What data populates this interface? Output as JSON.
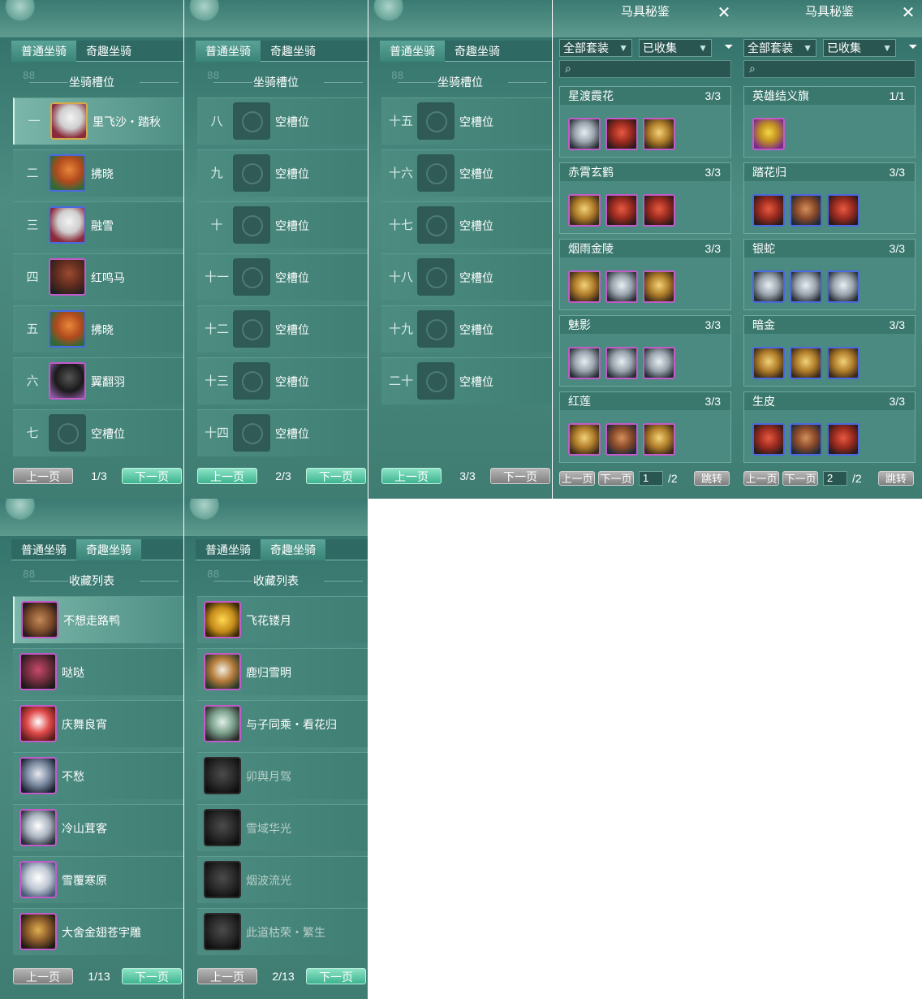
{
  "tabs": {
    "normal": "普通坐骑",
    "novelty": "奇趣坐骑"
  },
  "mount_slots_title": "坐骑槽位",
  "collection_list_title": "收藏列表",
  "ghost_text": "88",
  "pagination": {
    "prev": "上一页",
    "next": "下一页",
    "jump": "跳转"
  },
  "slot_panels": [
    {
      "page": "1/3",
      "slots": [
        {
          "num": "一",
          "label": "里飞沙・踏秋",
          "icon": "white-horse-icon"
        },
        {
          "num": "二",
          "label": "拂晓",
          "icon": "chestnut-horse-icon"
        },
        {
          "num": "三",
          "label": "融雪",
          "icon": "white-horse-icon"
        },
        {
          "num": "四",
          "label": "红鸣马",
          "icon": "brown-horse-icon"
        },
        {
          "num": "五",
          "label": "拂晓",
          "icon": "chestnut-horse-icon"
        },
        {
          "num": "六",
          "label": "翼翻羽",
          "icon": "black-horse-icon"
        },
        {
          "num": "七",
          "label": "空槽位",
          "icon": "empty-slot-icon"
        }
      ]
    },
    {
      "page": "2/3",
      "slots": [
        {
          "num": "八",
          "label": "空槽位"
        },
        {
          "num": "九",
          "label": "空槽位"
        },
        {
          "num": "十",
          "label": "空槽位"
        },
        {
          "num": "十一",
          "label": "空槽位"
        },
        {
          "num": "十二",
          "label": "空槽位"
        },
        {
          "num": "十三",
          "label": "空槽位"
        },
        {
          "num": "十四",
          "label": "空槽位"
        }
      ]
    },
    {
      "page": "3/3",
      "slots": [
        {
          "num": "十五",
          "label": "空槽位"
        },
        {
          "num": "十六",
          "label": "空槽位"
        },
        {
          "num": "十七",
          "label": "空槽位"
        },
        {
          "num": "十八",
          "label": "空槽位"
        },
        {
          "num": "十九",
          "label": "空槽位"
        },
        {
          "num": "二十",
          "label": "空槽位"
        }
      ]
    }
  ],
  "collection_panels": [
    {
      "title": "马具秘鉴",
      "filter_all": "全部套装",
      "filter_state": "已收集",
      "page_input": "1",
      "page_total": "/2",
      "sets": [
        {
          "name": "星渡霞花",
          "count": "3/3"
        },
        {
          "name": "赤霄玄鹤",
          "count": "3/3"
        },
        {
          "name": "烟雨金陵",
          "count": "3/3"
        },
        {
          "name": "魅影",
          "count": "3/3"
        },
        {
          "name": "红莲",
          "count": "3/3"
        }
      ]
    },
    {
      "title": "马具秘鉴",
      "filter_all": "全部套装",
      "filter_state": "已收集",
      "page_input": "2",
      "page_total": "/2",
      "sets": [
        {
          "name": "英雄结义旗",
          "count": "1/1"
        },
        {
          "name": "踏花归",
          "count": "3/3"
        },
        {
          "name": "银蛇",
          "count": "3/3"
        },
        {
          "name": "暗金",
          "count": "3/3"
        },
        {
          "name": "生皮",
          "count": "3/3"
        }
      ]
    }
  ],
  "novelty_panels": [
    {
      "page": "1/13",
      "items": [
        {
          "label": "不想走路鸭"
        },
        {
          "label": "哒哒"
        },
        {
          "label": "庆舞良宵"
        },
        {
          "label": "不愁"
        },
        {
          "label": "冷山茸客"
        },
        {
          "label": "雪覆寒原"
        },
        {
          "label": "大舍金翅苍宇雕"
        }
      ]
    },
    {
      "page": "2/13",
      "items": [
        {
          "label": "飞花镂月"
        },
        {
          "label": "鹿归雪明"
        },
        {
          "label": "与子同乘・看花归"
        },
        {
          "label": "卯舆月驾"
        },
        {
          "label": "雪域华光"
        },
        {
          "label": "烟波流光"
        },
        {
          "label": "此道枯荣・繁生"
        }
      ]
    }
  ]
}
